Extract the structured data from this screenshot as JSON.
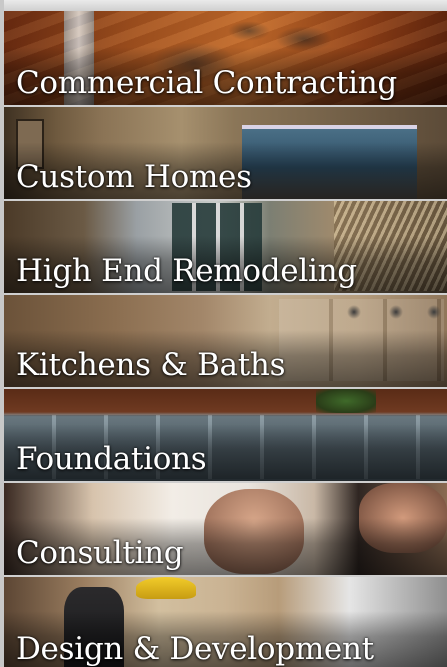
{
  "menu": {
    "items": [
      {
        "label": "Commercial Contracting",
        "photo": "commercial-interior-photo"
      },
      {
        "label": "Custom Homes",
        "photo": "custom-home-interior-photo"
      },
      {
        "label": "High End Remodeling",
        "photo": "remodeled-patio-photo"
      },
      {
        "label": "Kitchens & Baths",
        "photo": "bathroom-fixtures-photo"
      },
      {
        "label": "Foundations",
        "photo": "foundation-construction-photo"
      },
      {
        "label": "Consulting",
        "photo": "consulting-people-photo"
      },
      {
        "label": "Design & Development",
        "photo": "design-team-photo"
      }
    ]
  },
  "colors": {
    "label_text": "#ffffff",
    "background": "#cfcfcf"
  }
}
